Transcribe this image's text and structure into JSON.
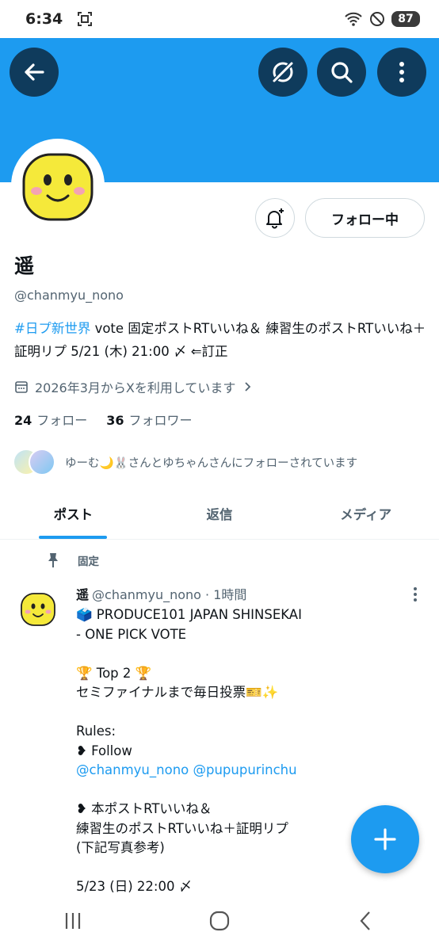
{
  "status": {
    "time": "6:34",
    "battery": "87"
  },
  "icons": {
    "back": "arrow-left-icon",
    "grok": "grok-icon",
    "search": "search-icon",
    "more": "more-vertical-icon",
    "bell": "bell-plus-icon",
    "calendar": "calendar-icon",
    "chevron": "chevron-right-icon",
    "pin": "pin-icon",
    "compose": "plus-icon"
  },
  "colors": {
    "accent": "#1d9bf0",
    "banner": "#1d9bf0",
    "button_dark": "#0f3b5c",
    "avatar_face": "#f5e93a"
  },
  "profile": {
    "follow_button": "フォロー中",
    "display_name": "遥",
    "handle": "@chanmyu_nono",
    "bio_hashtag": "#日プ新世界",
    "bio_text": " vote 固定ポストRTいいね＆ 練習生のポストRTいいね＋証明リプ 5/21 (木) 21:00 〆 ⇐訂正",
    "joined": "2026年3月からXを利用しています",
    "following_count": "24",
    "following_label": "フォロー",
    "followers_count": "36",
    "followers_label": "フォロワー",
    "followed_by": "ゆーむ🌙🐰さんとゆちゃんさんにフォローされています"
  },
  "tabs": [
    {
      "label": "ポスト",
      "active": true
    },
    {
      "label": "返信",
      "active": false
    },
    {
      "label": "メディア",
      "active": false
    }
  ],
  "post": {
    "pinned_label": "固定",
    "author": "遥",
    "handle_time": "@chanmyu_nono · 1時間",
    "lines": {
      "l1": "🗳️ PRODUCE101 JAPAN SHINSEKAI",
      "l2": "- ONE PICK VOTE",
      "l3": "🏆 Top 2 🏆",
      "l4": "セミファイナルまで毎日投票🎫✨",
      "l5": "Rules:",
      "l6": "❥ Follow",
      "l7_link": "@chanmyu_nono @pupupurinchu",
      "l8": "❥ 本ポストRTいいね＆",
      "l9": "練習生のポストRTいいね＋証明リプ",
      "l10": "(下記写真参考)",
      "l11": "5/23 (日) 22:00 〆"
    }
  }
}
